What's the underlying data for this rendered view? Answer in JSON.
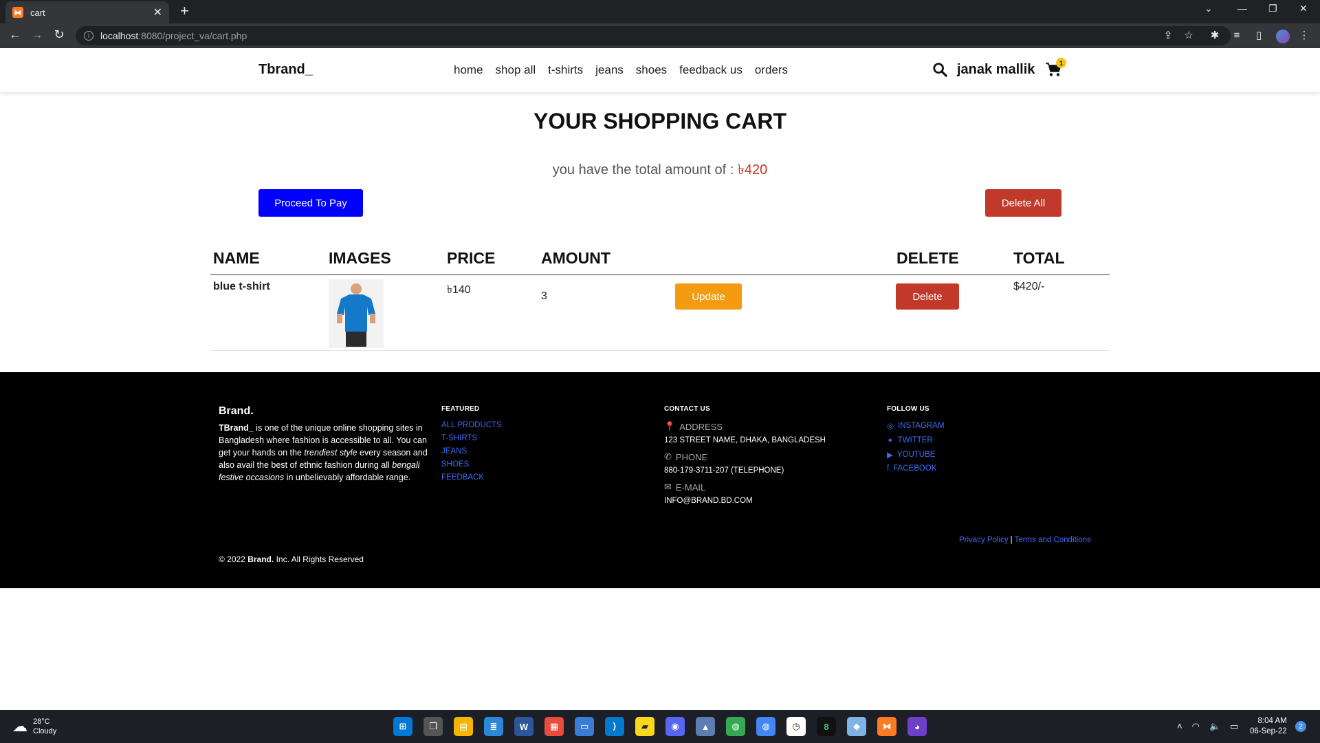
{
  "browser": {
    "tab_title": "cart",
    "favicon_letter": "⧓",
    "url_host": "localhost",
    "url_rest": ":8080/project_va/cart.php"
  },
  "site": {
    "brand": "Tbrand_",
    "menu": [
      "home",
      "shop all",
      "t-shirts",
      "jeans",
      "shoes",
      "feedback us",
      "orders"
    ],
    "user_name": "janak mallik",
    "cart_count": "1"
  },
  "cart": {
    "title": "YOUR SHOPPING CART",
    "total_prefix": "you have the total amount of : ",
    "total_amount": "৳420",
    "proceed_label": "Proceed To Pay",
    "delete_all_label": "Delete All",
    "headers": {
      "name": "NAME",
      "images": "IMAGES",
      "price": "PRICE",
      "amount": "AMOUNT",
      "delete": "DELETE",
      "total": "TOTAL"
    },
    "items": [
      {
        "name": "blue t-shirt",
        "price": "৳140",
        "amount": "3",
        "update_label": "Update",
        "delete_label": "Delete",
        "total": "$420/-"
      }
    ]
  },
  "footer": {
    "brand": "Brand.",
    "about_lead": "TBrand_",
    "about_1": " is one of the unique online shopping sites in Bangladesh where fashion is accessible to all. You can get your hands on the ",
    "about_em1": "trendiest style",
    "about_2": " every season and also avail the best of ethnic fashion during all ",
    "about_em2": "bengali festive occasions",
    "about_3": " in unbelievably affordable range.",
    "featured_heading": "FEATURED",
    "featured_links": [
      "ALL PRODUCTS",
      "T-SHIRTS",
      "JEANS",
      "SHOES",
      "FEEDBACK"
    ],
    "contact_heading": "CONTACT US",
    "address_label": "ADDRESS",
    "address_value": "123 STREET NAME, DHAKA, BANGLADESH",
    "phone_label": "PHONE",
    "phone_value": "880-179-3711-207 (TELEPHONE)",
    "email_label": "E-MAIL",
    "email_value": "INFO@BRAND.BD.COM",
    "follow_heading": "FOLLOW US",
    "social": [
      "INSTAGRAM",
      "TWITTER",
      "YOUTUBE",
      "FACEBOOK"
    ],
    "privacy": "Privacy Policy",
    "terms": "Terms and Conditions",
    "copy_prefix": "© 2022 ",
    "copy_brand": "Brand.",
    "copy_suffix": " Inc. All Rights Reserved"
  },
  "taskbar": {
    "temp": "28°C",
    "condition": "Cloudy",
    "time": "8:04 AM",
    "date": "06-Sep-22",
    "notifications": "2"
  },
  "colors": {
    "pay_button": "#0000ff",
    "danger": "#c0392b",
    "warning": "#f39c12",
    "footer_link": "#3b6cf6"
  }
}
